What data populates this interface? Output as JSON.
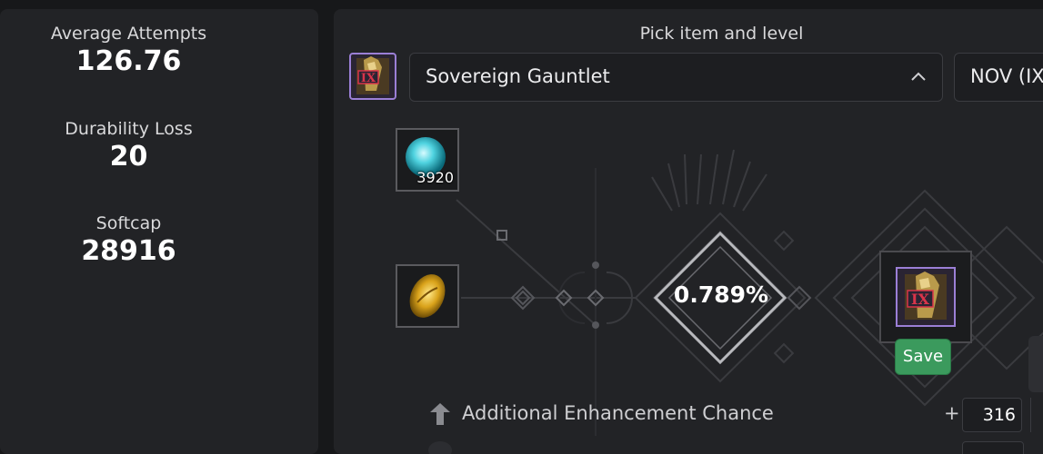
{
  "stats": {
    "attempts_label": "Average Attempts",
    "attempts_value": "126.76",
    "durability_label": "Durability Loss",
    "durability_value": "20",
    "softcap_label": "Softcap",
    "softcap_value": "28916"
  },
  "picker": {
    "title": "Pick item and level",
    "item_name": "Sovereign Gauntlet",
    "level_value": "NOV (IX",
    "item_tier": "IX"
  },
  "materials": {
    "top_count": "3920"
  },
  "enhance": {
    "chance": "0.789%",
    "save_label": "Save",
    "result_tier": "IX"
  },
  "bonus": {
    "label": "Additional Enhancement Chance",
    "plus": "+",
    "value": "316"
  },
  "colors": {
    "accent_purple": "#9b7fd6",
    "save_green": "#3b9a5d",
    "panel_bg": "#222326"
  },
  "icons": [
    "gauntlet-icon",
    "chevron-up-icon",
    "blue-stone-icon",
    "gold-stone-icon",
    "arrow-up-icon"
  ]
}
